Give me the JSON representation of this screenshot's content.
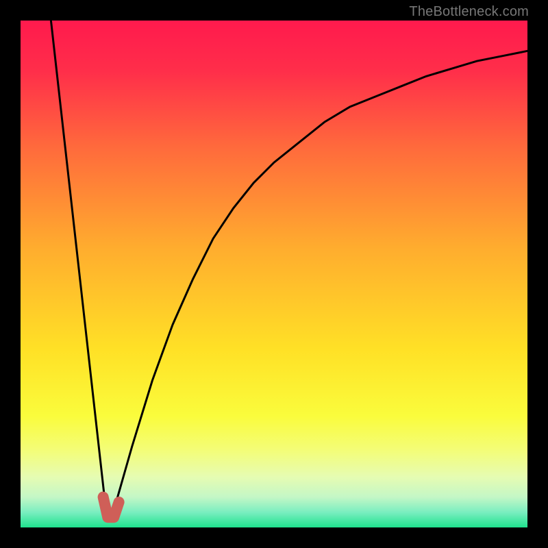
{
  "watermark": "TheBottleneck.com",
  "colors": {
    "black": "#000000",
    "curve_stroke": "#000000",
    "marker_fill": "#cf5f58",
    "gradient_stops": [
      {
        "offset": 0.0,
        "color": "#ff1a4d"
      },
      {
        "offset": 0.1,
        "color": "#ff2e4a"
      },
      {
        "offset": 0.25,
        "color": "#ff6a3c"
      },
      {
        "offset": 0.45,
        "color": "#ffad2e"
      },
      {
        "offset": 0.65,
        "color": "#ffe126"
      },
      {
        "offset": 0.78,
        "color": "#fafc3c"
      },
      {
        "offset": 0.85,
        "color": "#f3fd7a"
      },
      {
        "offset": 0.9,
        "color": "#e6fcb2"
      },
      {
        "offset": 0.94,
        "color": "#c4f7c6"
      },
      {
        "offset": 0.97,
        "color": "#7aeec0"
      },
      {
        "offset": 1.0,
        "color": "#1fe28d"
      }
    ]
  },
  "chart_data": {
    "type": "line",
    "title": "",
    "xlabel": "",
    "ylabel": "",
    "xlim": [
      0,
      100
    ],
    "ylim": [
      0,
      100
    ],
    "series": [
      {
        "name": "left-falling-line",
        "x": [
          6,
          17
        ],
        "values": [
          100,
          2
        ]
      },
      {
        "name": "right-rising-curve",
        "x": [
          18,
          22,
          26,
          30,
          34,
          38,
          42,
          46,
          50,
          55,
          60,
          65,
          70,
          75,
          80,
          85,
          90,
          95,
          100
        ],
        "values": [
          2,
          16,
          29,
          40,
          49,
          57,
          63,
          68,
          72,
          76,
          80,
          83,
          85,
          87,
          89,
          90.5,
          92,
          93,
          94
        ]
      }
    ],
    "marker": {
      "name": "minimum-marker",
      "x": [
        16.3,
        17.2,
        18.4,
        19.4
      ],
      "values": [
        6,
        2,
        2,
        5
      ]
    }
  }
}
